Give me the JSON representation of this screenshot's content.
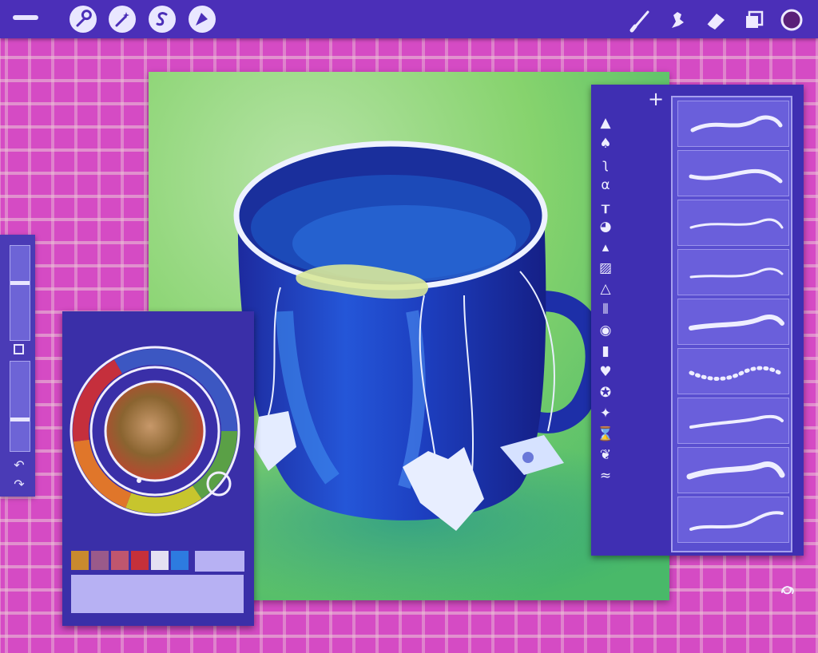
{
  "top_toolbar": {
    "left_tools": [
      {
        "icon": "wrench-icon"
      },
      {
        "icon": "magic-wand-icon"
      },
      {
        "icon": "selection-s-icon"
      },
      {
        "icon": "transform-arrow-icon"
      }
    ],
    "right_tools": [
      {
        "icon": "brush-icon"
      },
      {
        "icon": "smudge-icon"
      },
      {
        "icon": "eraser-icon"
      },
      {
        "icon": "layers-icon"
      },
      {
        "icon": "color-circle-icon"
      }
    ]
  },
  "color_panel": {
    "swatches": [
      "#c98a2e",
      "#9a5a8a",
      "#c0566e",
      "#c5303a",
      "#e4e0f2",
      "#2d7be0"
    ],
    "current_color": "#6b4a1e"
  },
  "brush_panel": {
    "brush_count": 9,
    "tool_icons": [
      "pen-nib-icon",
      "ink-pen-icon",
      "calligraphy-icon",
      "script-a-icon",
      "paint-roller-icon",
      "palette-icon",
      "spray-icon",
      "hatch-icon",
      "triangle-icon",
      "bars-icon",
      "globe-icon",
      "tube-icon",
      "shell-icon",
      "star-circle-icon",
      "sparkle-icon",
      "hourglass-icon",
      "leaf-icon",
      "wave-icon"
    ]
  },
  "colors": {
    "toolbar": "#4b2fb8",
    "background": "#d54bc4",
    "canvas": "#7ccf6c",
    "panel": "#3a2fa8"
  }
}
